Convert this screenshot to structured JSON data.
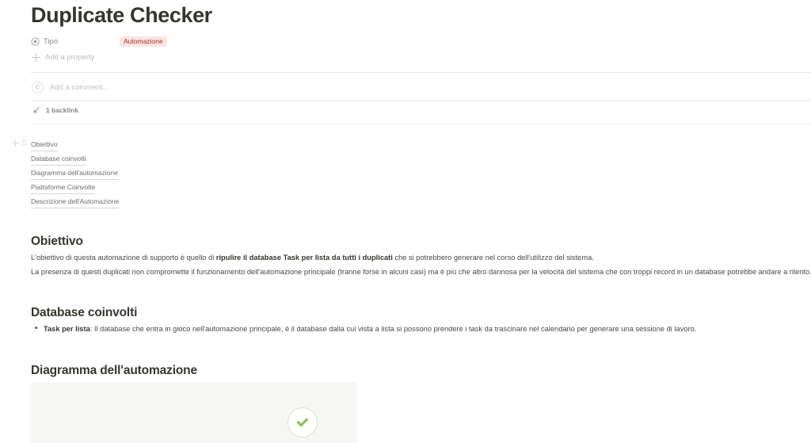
{
  "page": {
    "title": "Duplicate Checker"
  },
  "properties": {
    "rows": [
      {
        "icon": "select-icon",
        "label": "Tipo",
        "value": "Automazione",
        "value_bg": "#fbe4e4",
        "value_color": "#9d2f2f"
      }
    ],
    "add_property_label": "Add a property"
  },
  "comment": {
    "avatar_initial": "C",
    "placeholder": "Add a comment..."
  },
  "backlinks": {
    "icon": "backlink-arrow-icon",
    "label": "1 backlink"
  },
  "table_of_contents": {
    "items": [
      {
        "label": "Obiettivo"
      },
      {
        "label": "Database coinvolti"
      },
      {
        "label": "Diagramma dell'automazione"
      },
      {
        "label": "Piattaforme Coinvolte"
      },
      {
        "label": "Descrizione dell'Automazione"
      }
    ]
  },
  "sections": {
    "obiettivo": {
      "heading": "Obiettivo",
      "paragraph1": {
        "before": "L'obiettivo di questa automazione di supporto è quello di ",
        "bold": "ripulire il database Task per lista da tutti i duplicati",
        "after": " che si potrebbero generare nel corso dell'utilizzo del sistema."
      },
      "paragraph2": "La presenza di questi duplicati non compromette il funzionamento dell'automazione principale (tranne forse in alcuni casi) ma è più che altro dannosa per la velocità del sistema che con troppi record in un database potrebbe andare a rilento."
    },
    "database_coinvolti": {
      "heading": "Database coinvolti",
      "bullet": {
        "bold": "Task per lista",
        "text": ": Il database che entra in gioco nell'automazione principale, è il database dalla cui vista a lista si possono prendere i task da trascinare nel calendario per generare una sessione di lavoro."
      }
    },
    "diagramma": {
      "heading": "Diagramma dell'automazione",
      "panel": {
        "background": "#f6f6f5",
        "badge_icon": "check-icon",
        "badge_color": "#8cc152",
        "badge_ring_color": "#d5e8c4"
      }
    }
  }
}
